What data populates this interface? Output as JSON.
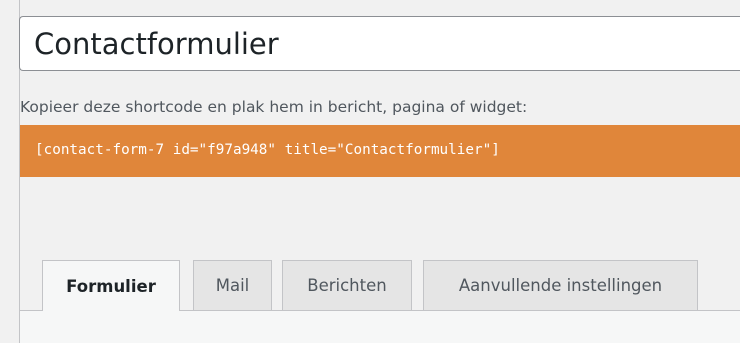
{
  "title_field": {
    "value": "Contactformulier"
  },
  "shortcode": {
    "label": "Kopieer deze shortcode en plak hem in bericht, pagina of widget:",
    "code": "[contact-form-7 id=\"f97a948\" title=\"Contactformulier\"]",
    "background_color": "#e0863a"
  },
  "tabs": [
    {
      "label": "Formulier",
      "active": true
    },
    {
      "label": "Mail",
      "active": false
    },
    {
      "label": "Berichten",
      "active": false
    },
    {
      "label": "Aanvullende instellingen",
      "active": false
    }
  ]
}
